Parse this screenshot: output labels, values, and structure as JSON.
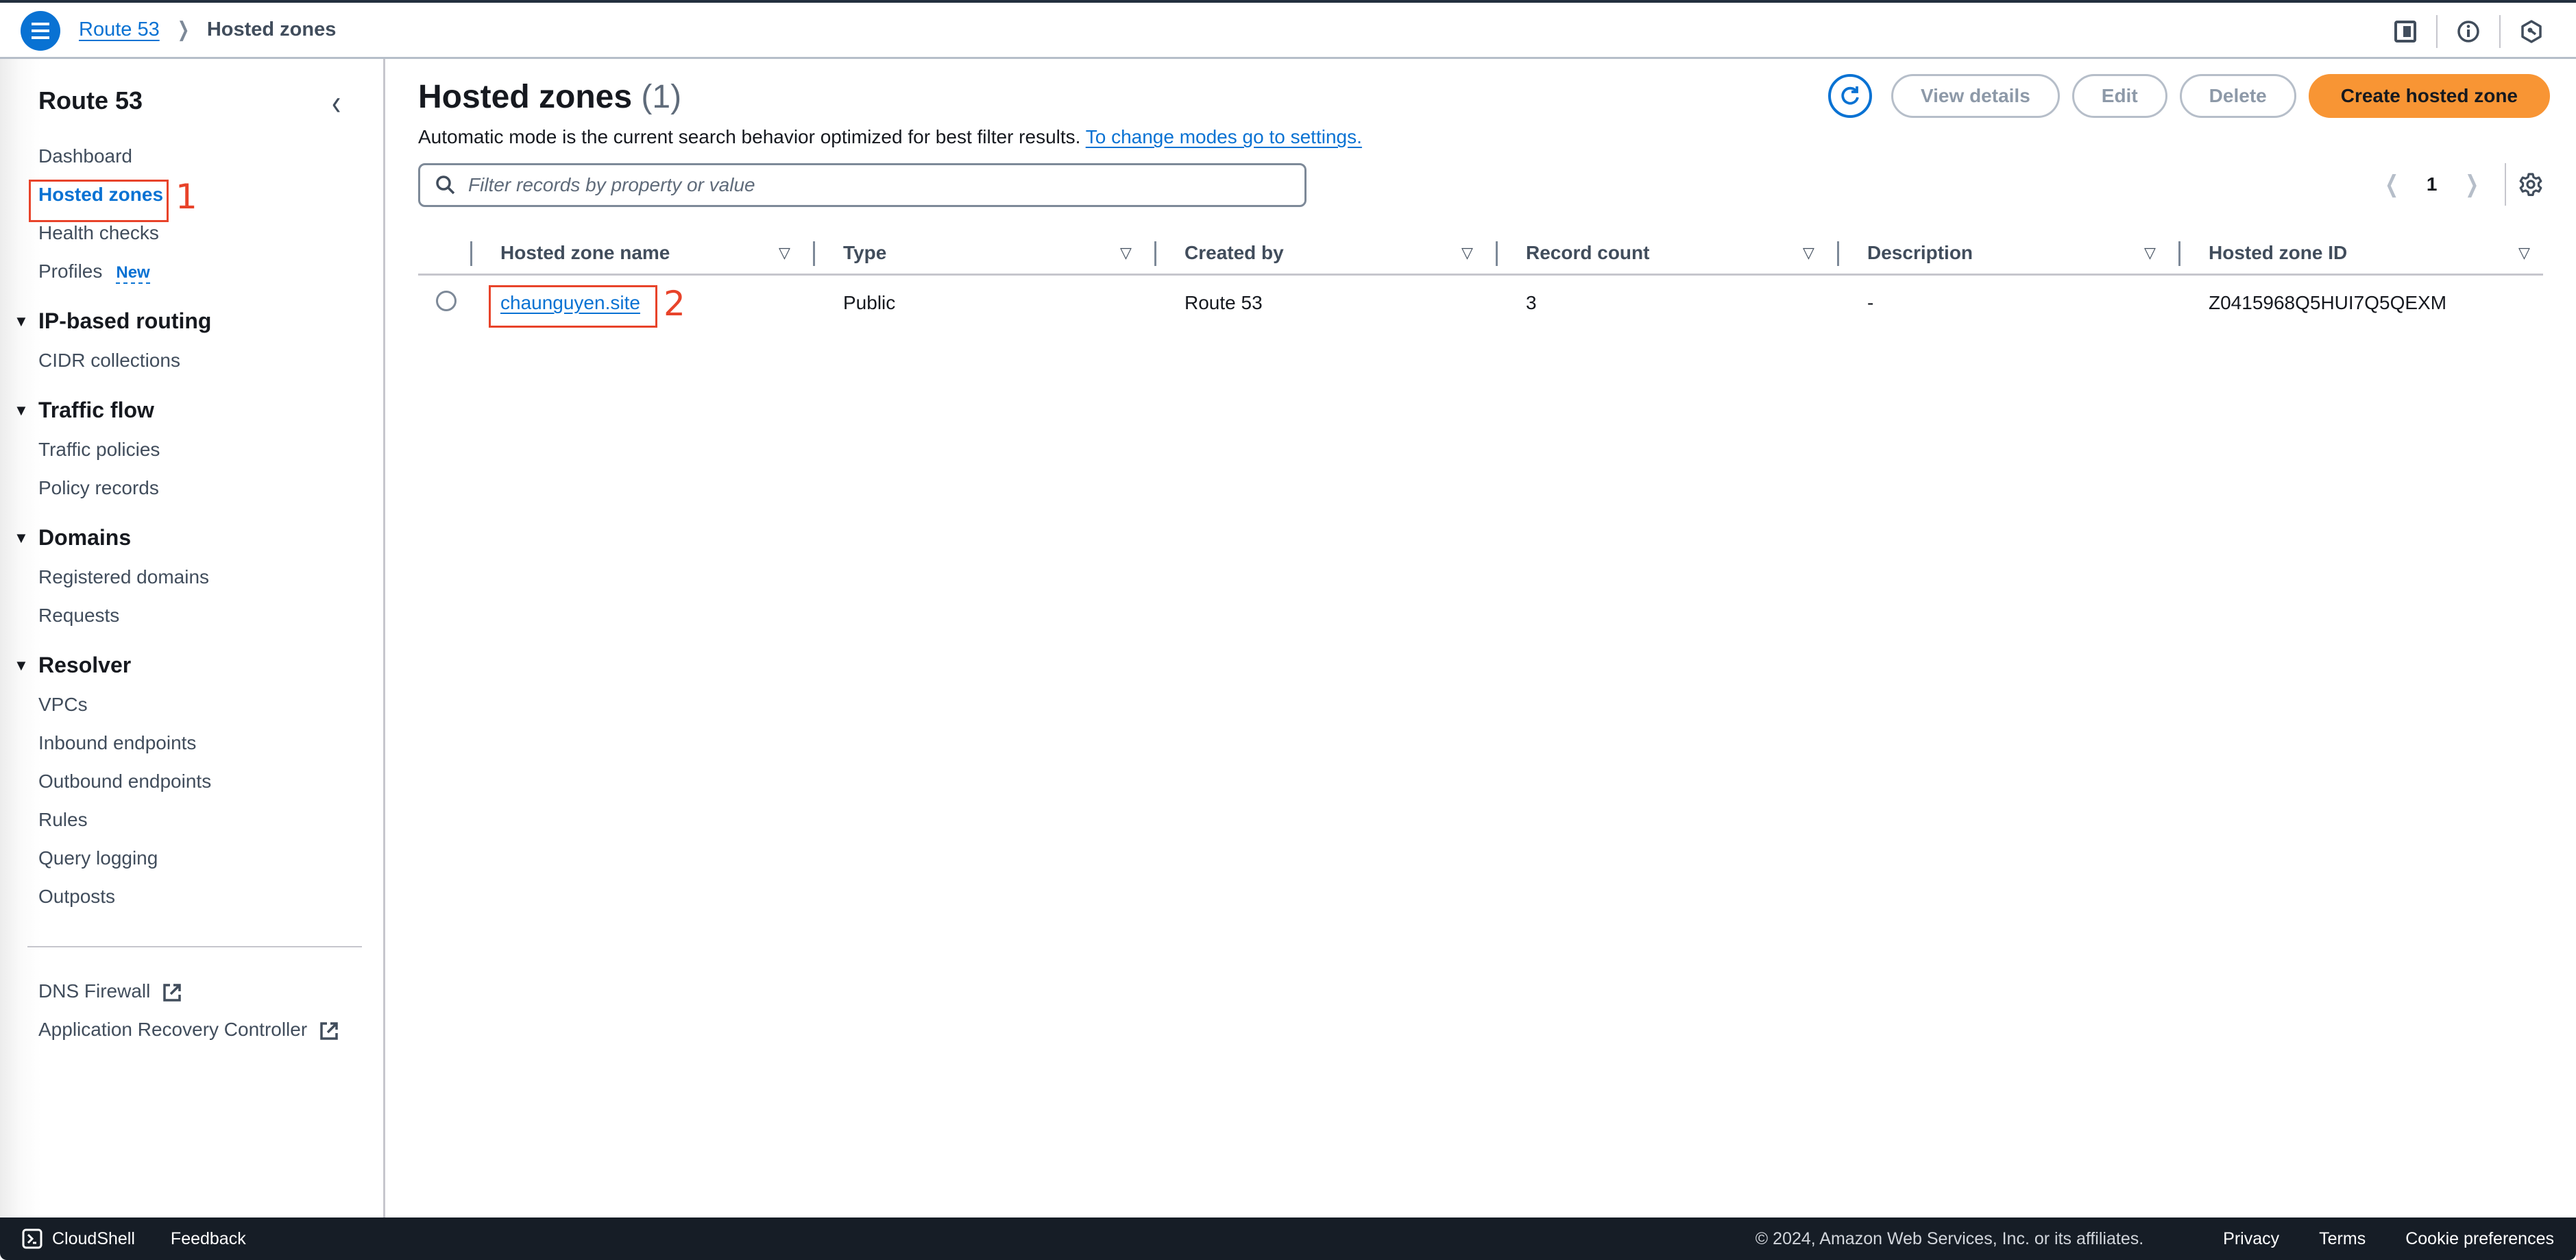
{
  "topbar": {
    "breadcrumb": [
      {
        "label": "Route 53",
        "link": true
      },
      {
        "label": "Hosted zones",
        "link": false
      }
    ],
    "icons": [
      "split-panel-icon",
      "info-icon",
      "notifications-icon"
    ]
  },
  "sidebar": {
    "title": "Route 53",
    "items": [
      {
        "label": "Dashboard"
      },
      {
        "label": "Hosted zones",
        "active": true
      },
      {
        "label": "Health checks"
      },
      {
        "label": "Profiles",
        "badge": "New"
      }
    ],
    "sections": [
      {
        "label": "IP-based routing",
        "items": [
          "CIDR collections"
        ]
      },
      {
        "label": "Traffic flow",
        "items": [
          "Traffic policies",
          "Policy records"
        ]
      },
      {
        "label": "Domains",
        "items": [
          "Registered domains",
          "Requests"
        ]
      },
      {
        "label": "Resolver",
        "items": [
          "VPCs",
          "Inbound endpoints",
          "Outbound endpoints",
          "Rules",
          "Query logging",
          "Outposts"
        ]
      }
    ],
    "external_links": [
      {
        "label": "DNS Firewall"
      },
      {
        "label": "Application Recovery Controller"
      }
    ]
  },
  "annotations": [
    "1",
    "2"
  ],
  "main": {
    "title": "Hosted zones",
    "count": "(1)",
    "info_text": "Automatic mode is the current search behavior optimized for best filter results.",
    "info_link": "To change modes go to settings.",
    "search": {
      "placeholder": "Filter records by property or value",
      "value": ""
    },
    "actions": {
      "view_details": "View details",
      "edit": "Edit",
      "delete": "Delete",
      "create": "Create hosted zone"
    },
    "pagination": {
      "current_page": "1"
    },
    "table": {
      "columns": [
        "Hosted zone name",
        "Type",
        "Created by",
        "Record count",
        "Description",
        "Hosted zone ID"
      ],
      "rows": [
        {
          "name": "chaunguyen.site",
          "type": "Public",
          "created_by": "Route 53",
          "record_count": "3",
          "description": "-",
          "zone_id": "Z0415968Q5HUI7Q5QEXM"
        }
      ]
    }
  },
  "footer": {
    "cloudshell": "CloudShell",
    "feedback": "Feedback",
    "copyright": "© 2024, Amazon Web Services, Inc. or its affiliates.",
    "privacy": "Privacy",
    "terms": "Terms",
    "cookies": "Cookie preferences"
  },
  "colors": {
    "accent_blue": "#0972d3",
    "primary_orange": "#f89534",
    "annotation_red": "#e8432a",
    "footer_bg": "#161d26"
  }
}
